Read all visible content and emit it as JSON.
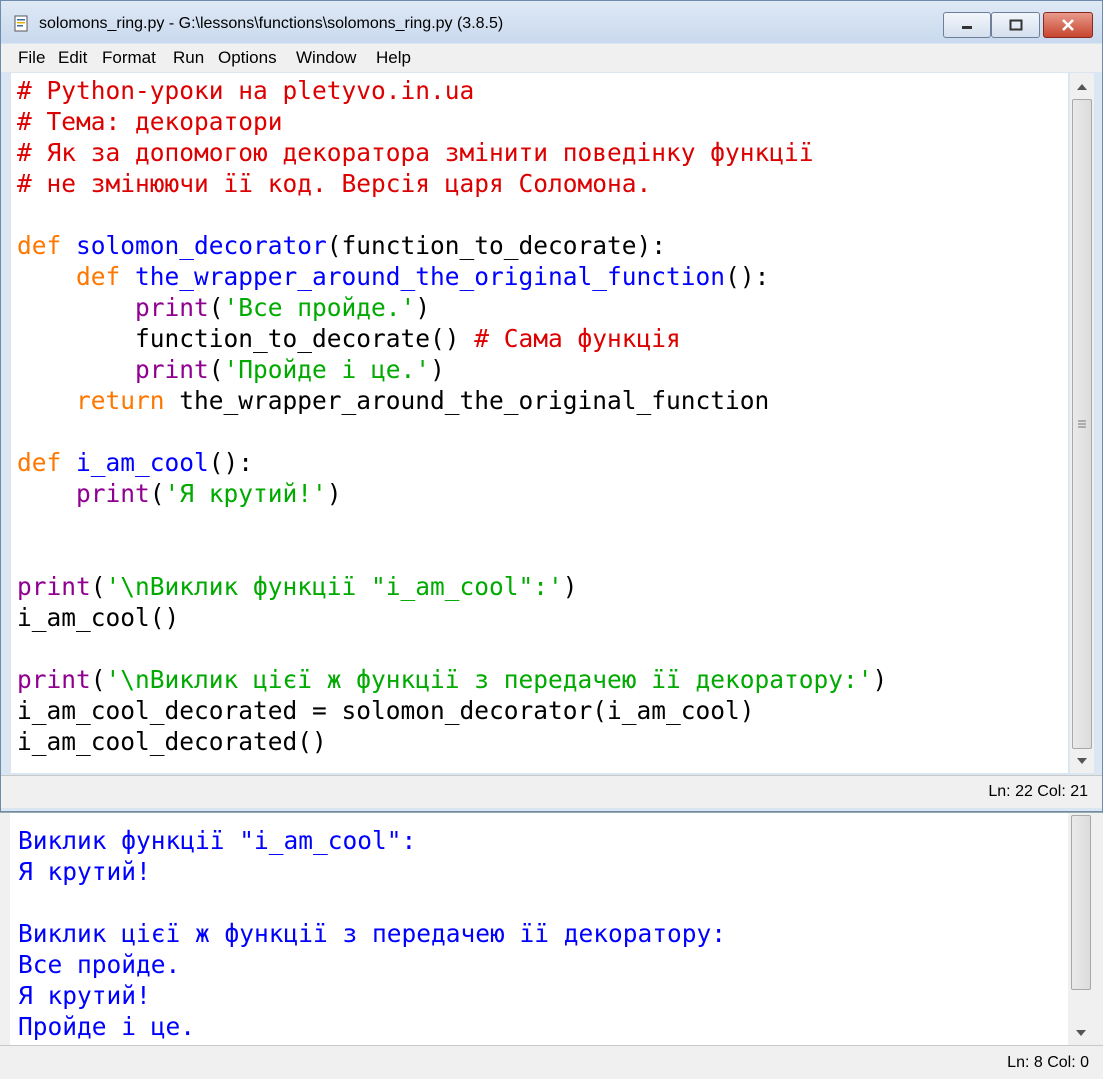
{
  "window": {
    "title": "solomons_ring.py - G:\\lessons\\functions\\solomons_ring.py (3.8.5)",
    "buttons": [
      "minimize",
      "maximize",
      "close"
    ]
  },
  "menu": [
    "File",
    "Edit",
    "Format",
    "Run",
    "Options",
    "Window",
    "Help"
  ],
  "editor": {
    "lines": [
      [
        {
          "t": "# Python-уроки на pletyvo.in.ua",
          "c": "comment"
        }
      ],
      [
        {
          "t": "# Тема: декоратори",
          "c": "comment"
        }
      ],
      [
        {
          "t": "# Як за допомогою декоратора змінити поведінку функції",
          "c": "comment"
        }
      ],
      [
        {
          "t": "# не змінюючи її код. Версія царя Соломона.",
          "c": "comment"
        }
      ],
      [],
      [
        {
          "t": "def",
          "c": "keyword"
        },
        {
          "t": " "
        },
        {
          "t": "solomon_decorator",
          "c": "defname"
        },
        {
          "t": "(function_to_decorate):"
        }
      ],
      [
        {
          "t": "    "
        },
        {
          "t": "def",
          "c": "keyword"
        },
        {
          "t": " "
        },
        {
          "t": "the_wrapper_around_the_original_function",
          "c": "defname"
        },
        {
          "t": "():"
        }
      ],
      [
        {
          "t": "        "
        },
        {
          "t": "print",
          "c": "builtin"
        },
        {
          "t": "("
        },
        {
          "t": "'Все пройде.'",
          "c": "string"
        },
        {
          "t": ")"
        }
      ],
      [
        {
          "t": "        function_to_decorate() "
        },
        {
          "t": "# Сама функція",
          "c": "comment"
        }
      ],
      [
        {
          "t": "        "
        },
        {
          "t": "print",
          "c": "builtin"
        },
        {
          "t": "("
        },
        {
          "t": "'Пройде і це.'",
          "c": "string"
        },
        {
          "t": ")"
        }
      ],
      [
        {
          "t": "    "
        },
        {
          "t": "return",
          "c": "keyword"
        },
        {
          "t": " the_wrapper_around_the_original_function"
        }
      ],
      [],
      [
        {
          "t": "def",
          "c": "keyword"
        },
        {
          "t": " "
        },
        {
          "t": "i_am_cool",
          "c": "defname"
        },
        {
          "t": "():"
        }
      ],
      [
        {
          "t": "    "
        },
        {
          "t": "print",
          "c": "builtin"
        },
        {
          "t": "("
        },
        {
          "t": "'Я крутий!'",
          "c": "string"
        },
        {
          "t": ")"
        }
      ],
      [],
      [],
      [
        {
          "t": "print",
          "c": "builtin"
        },
        {
          "t": "("
        },
        {
          "t": "'\\nВиклик функції \"i_am_cool\":'",
          "c": "string"
        },
        {
          "t": ")"
        }
      ],
      [
        {
          "t": "i_am_cool()"
        }
      ],
      [],
      [
        {
          "t": "print",
          "c": "builtin"
        },
        {
          "t": "("
        },
        {
          "t": "'\\nВиклик цієї ж функції з передачею її декоратору:'",
          "c": "string"
        },
        {
          "t": ")"
        }
      ],
      [
        {
          "t": "i_am_cool_decorated = solomon_decorator(i_am_cool)"
        }
      ],
      [
        {
          "t": "i_am_cool_decorated()"
        }
      ]
    ],
    "status": "Ln: 22  Col: 21"
  },
  "shell": {
    "lines": [
      "Виклик функції \"i_am_cool\":",
      "Я крутий!",
      "",
      "Виклик цієї ж функції з передачею її декоратору:",
      "Все пройде.",
      "Я крутий!",
      "Пройде і це."
    ],
    "status": "Ln: 8  Col: 0"
  }
}
